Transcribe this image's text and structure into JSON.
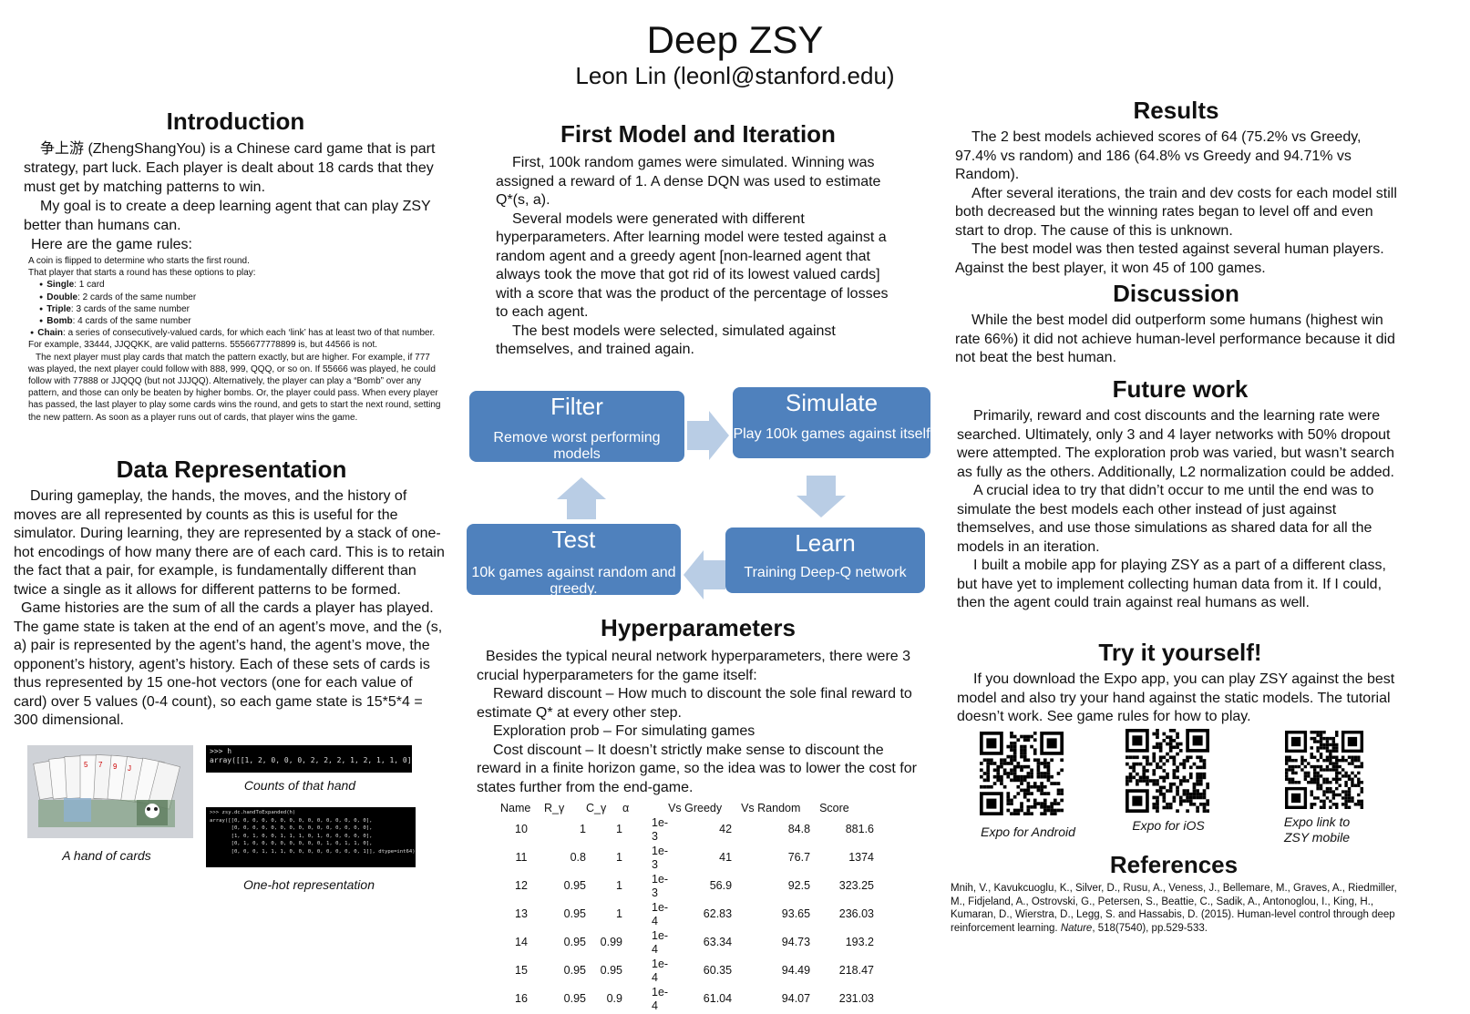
{
  "header": {
    "title": "Deep ZSY",
    "author": "Leon Lin (leonl@stanford.edu)"
  },
  "intro": {
    "heading": "Introduction",
    "p1": "争上游 (ZhengShangYou) is a Chinese card game that is part strategy, part luck. Each player is dealt about 18 cards that they must get by matching patterns to win.",
    "p2": "My goal is to create a deep learning agent that can play ZSY better than humans can.",
    "p3": "Here are the game rules:",
    "rules_lead": "A coin is flipped to determine who starts the first round.",
    "rules_lead2": "That player that starts a round has these options to play:",
    "rules": [
      {
        "name": "Single",
        "desc": ": 1 card"
      },
      {
        "name": "Double",
        "desc": ": 2 cards of the same number"
      },
      {
        "name": "Triple",
        "desc": ": 3 cards of the same number"
      },
      {
        "name": "Bomb",
        "desc": ": 4 cards of the same number"
      },
      {
        "name": "Chain",
        "desc": ": a series of consecutively-valued cards, for which each ‘link’ has at least two of that number. For example, 33444, JJQQKK, are valid patterns. 5556677778899 is, but 44566 is not."
      }
    ],
    "rules_tail": "The next player must play cards that match the pattern exactly, but are higher. For example, if 777 was played, the next player could follow with 888, 999, QQQ, or so on. If 55666 was played, he could follow with 77888 or JJQQQ (but not JJJQQ). Alternatively, the player can play a “Bomb” over any pattern, and those can only be beaten by higher bombs. Or, the player could pass. When every player has passed, the last player to play some cards wins the round, and gets to start the next round, setting the new pattern. As soon as a player runs out of cards, that player wins the game."
  },
  "datarep": {
    "heading": "Data Representation",
    "p1": "During gameplay, the hands, the moves, and the history of moves are all represented by counts as this is useful for the simulator. During learning, they are represented by a stack of one-hot encodings of how many there are of each card. This is to retain the fact that a pair, for example, is fundamentally different than twice a single as it allows for different patterns to be formed.",
    "p2": "Game histories are the sum of all the cards a player has played. The game state is taken at the end of an agent’s move, and the (s, a) pair is represented by the agent’s hand, the agent’s move, the opponent’s history, agent’s history. Each of these sets of cards is thus represented by 15 one-hot vectors (one for each value of card) over 5 values (0-4 count), so each game state is 15*5*4 = 300 dimensional.",
    "cap_hand": "A hand of cards",
    "cap_counts": "Counts of that hand",
    "cap_onehot": "One-hot representation",
    "term1": ">>> h\narray([[1, 2, 0, 0, 0, 2, 2, 2, 1, 2, 1, 1, 0]])",
    "term2": ">>> zsy.dc.handToExpanded(h)\narray([[0, 0, 0, 0, 0, 0, 0, 0, 0, 0, 0, 0, 0, 0, 0],\n       [0, 0, 0, 0, 0, 0, 0, 0, 0, 0, 0, 0, 0, 0, 0],\n       [1, 0, 1, 0, 0, 1, 1, 1, 0, 1, 0, 0, 0, 0, 0],\n       [0, 1, 0, 0, 0, 0, 0, 0, 0, 0, 1, 0, 1, 1, 0],\n       [0, 0, 0, 1, 1, 1, 0, 0, 0, 0, 0, 0, 0, 0, 1]], dtype=int64)"
  },
  "firstmodel": {
    "heading": "First Model and Iteration",
    "p1": "First, 100k random games were simulated. Winning was assigned a reward of 1. A dense DQN was used to estimate Q*(s, a).",
    "p2": "Several models were generated with different hyperparameters. After learning model were tested against a random agent and a greedy agent [non-learned agent that always took the move that got rid of its lowest valued cards] with a score that was the product of the percentage of losses to each agent.",
    "p3": "The best models were selected, simulated against themselves, and trained again."
  },
  "cycle": {
    "filter_title": "Filter",
    "filter_desc": "Remove worst performing models",
    "simulate_title": "Simulate",
    "simulate_desc": "Play 100k games against itself",
    "learn_title": "Learn",
    "learn_desc": "Training Deep-Q network",
    "test_title": "Test",
    "test_desc": "10k games against random and greedy."
  },
  "hyper": {
    "heading": "Hyperparameters",
    "p1": "Besides the typical neural network hyperparameters, there were 3 crucial hyperparameters for the game itself:",
    "p2": "Reward discount – How much to discount the sole final reward to estimate Q* at every other step.",
    "p3": "Exploration prob – For simulating games",
    "p4": "Cost discount – It doesn’t strictly make sense to discount the reward in a finite horizon game, so the idea was to lower the cost for states further from the end-game.",
    "columns": [
      "Name",
      "R_γ",
      "C_γ",
      "α",
      "Vs Greedy",
      "Vs Random",
      "Score"
    ],
    "rows": [
      [
        "10",
        "1",
        "1",
        "1e-3",
        "42",
        "84.8",
        "881.6"
      ],
      [
        "11",
        "0.8",
        "1",
        "1e-3",
        "41",
        "76.7",
        "1374"
      ],
      [
        "12",
        "0.95",
        "1",
        "1e-3",
        "56.9",
        "92.5",
        "323.25"
      ],
      [
        "13",
        "0.95",
        "1",
        "1e-4",
        "62.83",
        "93.65",
        "236.03"
      ],
      [
        "14",
        "0.95",
        "0.99",
        "1e-4",
        "63.34",
        "94.73",
        "193.2"
      ],
      [
        "15",
        "0.95",
        "0.95",
        "1e-4",
        "60.35",
        "94.49",
        "218.47"
      ],
      [
        "16",
        "0.95",
        "0.9",
        "1e-4",
        "61.04",
        "94.07",
        "231.03"
      ]
    ]
  },
  "results": {
    "heading": "Results",
    "p1": "The 2 best models achieved scores of 64 (75.2% vs Greedy, 97.4% vs random) and 186 (64.8% vs Greedy and 94.71% vs Random).",
    "p2": "After several iterations, the train and dev costs for each model still both decreased but the winning rates began to level off and even start to drop. The cause of this is unknown.",
    "p3": "The best model was then tested against several human players. Against the best player, it won 45 of 100 games."
  },
  "discussion": {
    "heading": "Discussion",
    "p1": "While the best model did outperform some humans (highest win rate 66%) it did not achieve human-level performance because it did not beat the best human."
  },
  "future": {
    "heading": "Future work",
    "p1": "Primarily, reward and cost discounts and the learning rate were searched. Ultimately, only 3 and 4 layer networks with 50% dropout were attempted. The exploration prob was varied, but wasn’t search as fully as the others. Additionally, L2 normalization could be added.",
    "p2": "A crucial idea to try that didn’t occur to me until the end was to simulate the best models each other instead of just against themselves, and use those simulations as shared data for all the models in an iteration.",
    "p3": "I built a mobile app for playing ZSY as a part of a different class, but have yet to implement collecting human data from it. If I could, then the agent could train against real humans as well."
  },
  "tryit": {
    "heading": "Try it yourself!",
    "p1": "If you download the Expo app, you can play ZSY against the best model and also try your hand against the static models. The tutorial doesn’t work. See game rules for how to play.",
    "qr1": "Expo for Android",
    "qr2": "Expo for iOS",
    "qr3a": "Expo link to",
    "qr3b": "ZSY mobile"
  },
  "refs": {
    "heading": "References",
    "text1": "Mnih, V., Kavukcuoglu, K., Silver, D., Rusu, A., Veness, J., Bellemare, M., Graves, A., Riedmiller, M., Fidjeland, A., Ostrovski, G., Petersen, S., Beattie, C., Sadik, A., Antonoglou, I., King, H., Kumaran, D., Wierstra, D., Legg, S. and Hassabis, D. (2015). Human-level control through deep reinforcement learning. ",
    "journal": "Nature",
    "text2": ", 518(7540), pp.529-533."
  },
  "colors": {
    "box": "#4f81bd",
    "arrow": "#b9cde5"
  }
}
